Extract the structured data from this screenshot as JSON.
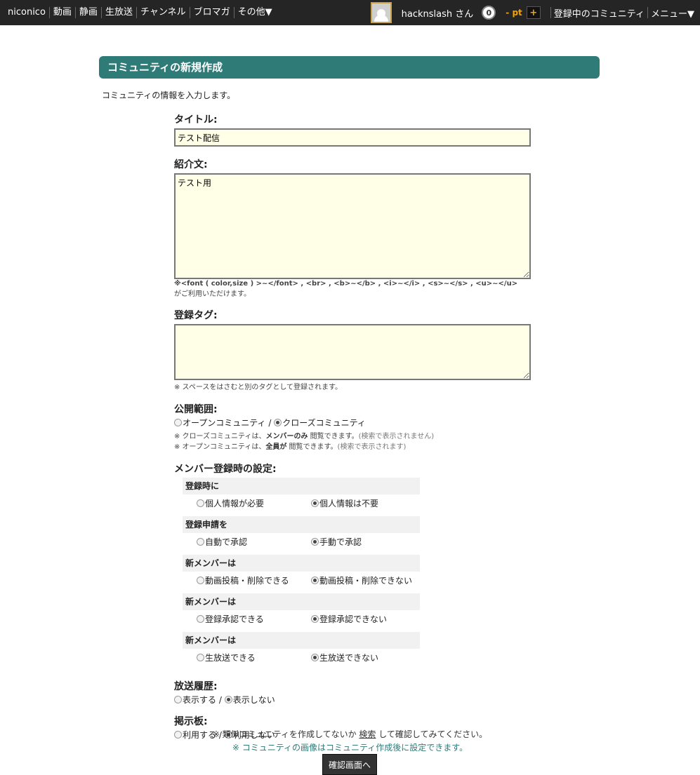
{
  "topbar": {
    "nav": [
      "niconico",
      "動画",
      "静画",
      "生放送",
      "チャンネル",
      "ブロマガ",
      "その他▼"
    ],
    "username": "hacknslash さん",
    "notifications": "0",
    "points": "- pt",
    "plus": "+",
    "communities": "登録中のコミュニティ",
    "menu": "メニュー▼"
  },
  "header": {
    "title": "コミュニティの新規作成"
  },
  "intro": "コミュニティの情報を入力します。",
  "form": {
    "title_label": "タイトル:",
    "title_value": "テスト配信",
    "desc_label": "紹介文:",
    "desc_value": "テスト用",
    "desc_note1": "※<font ( color,size ) >~</font> , <br> , <b>~</b> , <i>~</i> , <s>~</s> , <u>~</u>",
    "desc_note2": "がご利用いただけます。",
    "tags_label": "登録タグ:",
    "tags_value": "",
    "tags_note": "※ スペースをはさむと別のタグとして登録されます。",
    "scope_label": "公開範囲:",
    "scope_open": "オープンコミュニティ",
    "scope_sep": " / ",
    "scope_closed": "クローズコミュニティ",
    "scope_note1_a": "※ クローズコミュニティは、",
    "scope_note1_b": "メンバーのみ",
    "scope_note1_c": " 閲覧できます。",
    "scope_note1_d": "(検索で表示されません)",
    "scope_note2_a": "※ オープンコミュニティは、",
    "scope_note2_b": "全員が",
    "scope_note2_c": " 閲覧できます。",
    "scope_note2_d": "(検索で表示されます)",
    "member_label": "メンバー登録時の設定:",
    "member_groups": [
      {
        "heading": "登録時に",
        "opt1": "個人情報が必要",
        "opt2": "個人情報は不要"
      },
      {
        "heading": "登録申請を",
        "opt1": "自動で承認",
        "opt2": "手動で承認"
      },
      {
        "heading": "新メンバーは",
        "opt1": "動画投稿・削除できる",
        "opt2": "動画投稿・削除できない"
      },
      {
        "heading": "新メンバーは",
        "opt1": "登録承認できる",
        "opt2": "登録承認できない"
      },
      {
        "heading": "新メンバーは",
        "opt1": "生放送できる",
        "opt2": "生放送できない"
      }
    ],
    "history_label": "放送履歴:",
    "history_opt1": "表示する",
    "history_opt2": "表示しない",
    "board_label": "掲示板:",
    "board_opt1": "利用する",
    "board_opt2": "利用しない",
    "or_sep": " / "
  },
  "bottom": {
    "note1_a": "※ 類似コミュニティを作成してないか ",
    "note1_link": "検索",
    "note1_b": " して確認してみてください。",
    "note2": "※ コミュニティの画像はコミュニティ作成後に設定できます。",
    "confirm": "確認画面へ"
  }
}
